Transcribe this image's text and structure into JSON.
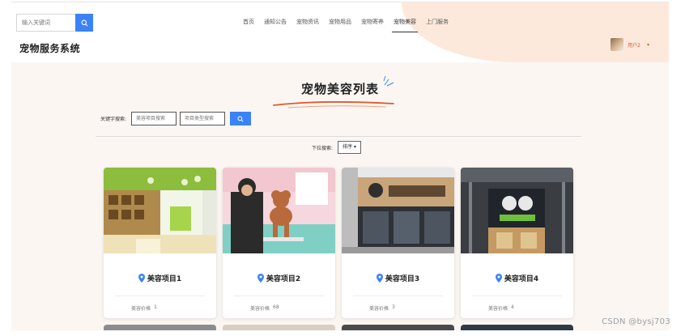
{
  "header": {
    "search_placeholder": "输入关键词",
    "brand": "宠物服务系统",
    "nav": [
      "首页",
      "通知公告",
      "宠物资讯",
      "宠物用品",
      "宠物寄养",
      "宠物美容",
      "上门服务"
    ],
    "active_nav_index": 5,
    "user_name": "用户2"
  },
  "page": {
    "title": "宠物美容列表",
    "filter_label": "关键字搜索:",
    "filter_name_placeholder": "美容项目搜索",
    "filter_type_placeholder": "项目类型搜索",
    "sort_label": "下拉搜索:",
    "sort_button": "排序"
  },
  "cards": [
    {
      "name": "美容项目1",
      "price_label": "美容价格",
      "price": "1"
    },
    {
      "name": "美容项目2",
      "price_label": "美容价格",
      "price": "68"
    },
    {
      "name": "美容项目3",
      "price_label": "美容价格",
      "price": "3"
    },
    {
      "name": "美容项目4",
      "price_label": "美容价格",
      "price": "4"
    }
  ],
  "colors": {
    "primary": "#3b82f6",
    "accent": "#e05a2c",
    "header_peach": "#fde9dc",
    "page_bg": "#fbf6f2"
  },
  "watermark": "CSDN @bysj703"
}
